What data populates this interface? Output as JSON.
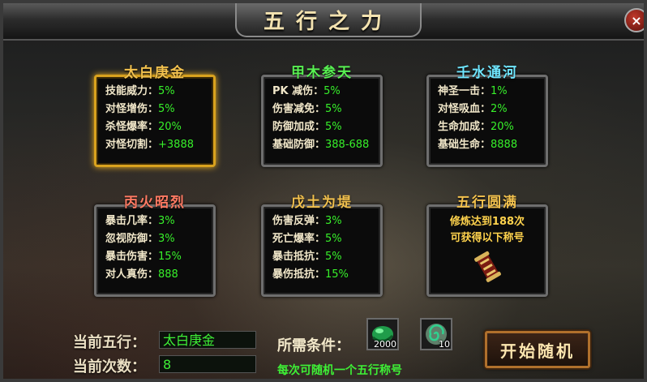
{
  "window": {
    "title": "五行之力",
    "close_label": "×"
  },
  "cards": [
    {
      "id": "jin",
      "title": "太白庚金",
      "title_color": "#f2c14e",
      "active": true,
      "stats": [
        {
          "k": "技能威力：",
          "v": "5%"
        },
        {
          "k": "对怪增伤：",
          "v": "5%"
        },
        {
          "k": "杀怪爆率：",
          "v": "20%"
        },
        {
          "k": "对怪切割：",
          "v": "+3888"
        }
      ]
    },
    {
      "id": "mu",
      "title": "甲木参天",
      "title_color": "#58f052",
      "active": false,
      "stats": [
        {
          "k": "PK 减伤：",
          "v": "5%"
        },
        {
          "k": "伤害减免：",
          "v": "5%"
        },
        {
          "k": "防御加成：",
          "v": "5%"
        },
        {
          "k": "基础防御：",
          "v": "388-688"
        }
      ]
    },
    {
      "id": "shui",
      "title": "壬水通河",
      "title_color": "#6fe6ff",
      "active": false,
      "stats": [
        {
          "k": "神圣一击：",
          "v": "1%"
        },
        {
          "k": "对怪吸血：",
          "v": "2%"
        },
        {
          "k": "生命加成：",
          "v": "20%"
        },
        {
          "k": "基础生命：",
          "v": "8888"
        }
      ]
    },
    {
      "id": "huo",
      "title": "丙火昭烈",
      "title_color": "#ff7a63",
      "active": false,
      "stats": [
        {
          "k": "暴击几率：",
          "v": "3%"
        },
        {
          "k": "忽视防御：",
          "v": "3%"
        },
        {
          "k": "暴击伤害：",
          "v": "15%"
        },
        {
          "k": "对人真伤：",
          "v": "888"
        }
      ]
    },
    {
      "id": "tu",
      "title": "戊土为堤",
      "title_color": "#f2c14e",
      "active": false,
      "stats": [
        {
          "k": "伤害反弹：",
          "v": "3%"
        },
        {
          "k": "死亡爆率：",
          "v": "5%"
        },
        {
          "k": "暴击抵抗：",
          "v": "5%"
        },
        {
          "k": "暴伤抵抗：",
          "v": "15%"
        }
      ]
    }
  ],
  "complete_card": {
    "title": "五行圆满",
    "line1": "修炼达到188次",
    "line2": "可获得以下称号",
    "icon": "scroll-icon"
  },
  "current": {
    "element_label": "当前五行：",
    "element_value": "太白庚金",
    "count_label": "当前次数：",
    "count_value": "8"
  },
  "requirements": {
    "label": "所需条件：",
    "items": [
      {
        "icon": "jade-orb-icon",
        "count": "2000"
      },
      {
        "icon": "spiral-stone-icon",
        "count": "10"
      }
    ],
    "hint": "每次可随机一个五行称号"
  },
  "start_button": {
    "label": "开始随机"
  }
}
